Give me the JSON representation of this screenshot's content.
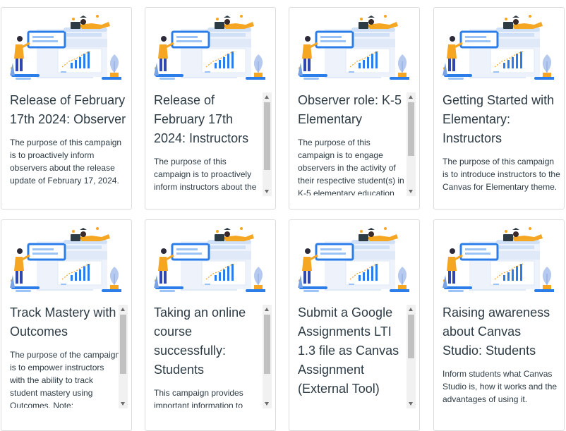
{
  "colors": {
    "text": "#2d3b45",
    "accent_blue": "#2b7de9",
    "figure_orange": "#f5a623",
    "scrollbar_thumb": "#c1c1c1"
  },
  "illustration": {
    "icon": "campaign-illustration-icon"
  },
  "cards": [
    {
      "title": "Release of February 17th 2024: Observer",
      "description": "The purpose of this campaign is to proactively inform observers about the release update of February 17, 2024."
    },
    {
      "title": "Release of February 17th 2024: Instructors",
      "description": "The purpose of this campaign is to proactively inform instructors about the"
    },
    {
      "title": "Observer role: K-5 Elementary",
      "description": "The purpose of this campaign is to engage observers in the activity of their respective student(s) in K-5 elementary education"
    },
    {
      "title": "Getting Started with Elementary: Instructors",
      "description": "The purpose of this campaign is to introduce instructors to the Canvas for Elementary theme."
    },
    {
      "title": "Track Mastery with Outcomes",
      "description": "The purpose of the campaign is to empower instructors with the ability to track student mastery using Outcomes. Note:"
    },
    {
      "title": "Taking an online course successfully: Students",
      "description": "This campaign provides important information to"
    },
    {
      "title": "Submit a Google Assignments LTI 1.3 file as Canvas Assignment (External Tool)",
      "description": ""
    },
    {
      "title": "Raising awareness about Canvas Studio: Students",
      "description": "Inform students what Canvas Studio is, how it works and the advantages of using it."
    }
  ]
}
